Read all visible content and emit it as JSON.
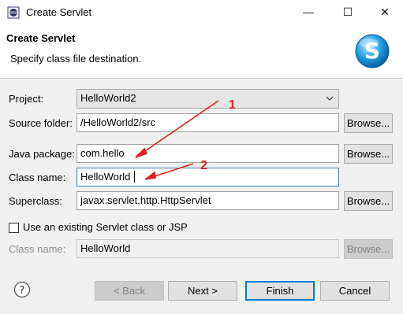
{
  "window": {
    "title": "Create Servlet",
    "minimize": "—",
    "maximize": "☐",
    "close": "✕"
  },
  "header": {
    "title": "Create Servlet",
    "subtitle": "Specify class file destination.",
    "logo_letter": "S"
  },
  "form": {
    "project": {
      "label": "Project:",
      "value": "HelloWorld2"
    },
    "source_folder": {
      "label": "Source folder:",
      "value": "/HelloWorld2/src",
      "browse": "Browse..."
    },
    "java_package": {
      "label": "Java package:",
      "value": "com.hello",
      "browse": "Browse..."
    },
    "class_name": {
      "label": "Class name:",
      "value": "HelloWorld"
    },
    "superclass": {
      "label": "Superclass:",
      "value": "javax.servlet.http.HttpServlet",
      "browse": "Browse..."
    },
    "existing": {
      "label": "Use an existing Servlet class or JSP",
      "checked": false
    },
    "existing_class": {
      "label": "Class name:",
      "value": "HelloWorld",
      "browse": "Browse..."
    }
  },
  "annotations": {
    "arrow1": "1",
    "arrow2": "2",
    "color": "#e02020"
  },
  "footer": {
    "help": "?",
    "back": "< Back",
    "next": "Next >",
    "finish": "Finish",
    "cancel": "Cancel"
  },
  "colors": {
    "accent": "#0078d7",
    "logo": "#1a9be0"
  }
}
